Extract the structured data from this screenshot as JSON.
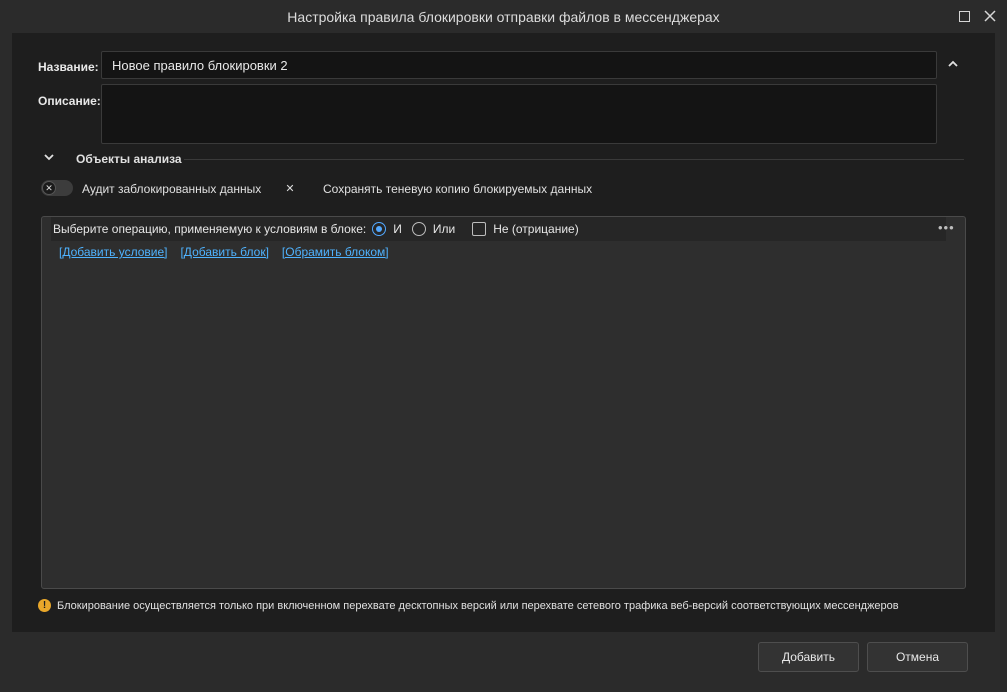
{
  "window": {
    "title": "Настройка правила блокировки отправки файлов в мессенджерах",
    "max_icon": "maximize-icon",
    "close_icon": "close-icon"
  },
  "form": {
    "name_label": "Название:",
    "name_value": "Новое правило блокировки 2",
    "description_label": "Описание:",
    "description_value": ""
  },
  "section": {
    "title": "Объекты анализа",
    "expanded": true
  },
  "toggles": {
    "audit_label": "Аудит заблокированных данных",
    "audit_on": false,
    "shadow_label": "Сохранять теневую копию блокируемых данных",
    "shadow_on": false,
    "off_glyph": "✕"
  },
  "block": {
    "operation_label": "Выберите операцию, применяемую к условиям в блоке:",
    "and_label": "И",
    "and_selected": true,
    "or_label": "Или",
    "or_selected": false,
    "not_label": "Не (отрицание)",
    "not_checked": false,
    "more_glyph": "•••",
    "links": {
      "add_condition": "[Добавить условие]",
      "add_block": "[Добавить блок]",
      "wrap_block": "[Обрамить блоком]"
    }
  },
  "notice": {
    "icon_glyph": "!",
    "text": "Блокирование осуществляется только при включенном перехвате десктопных версий или перехвате сетевого трафика веб-версий соответствующих мессенджеров"
  },
  "footer": {
    "add_label": "Добавить",
    "cancel_label": "Отмена"
  },
  "colors": {
    "accent": "#52a8ff",
    "link": "#4fb3ff",
    "warning": "#e9a72a",
    "background": "#1e1e1e"
  }
}
